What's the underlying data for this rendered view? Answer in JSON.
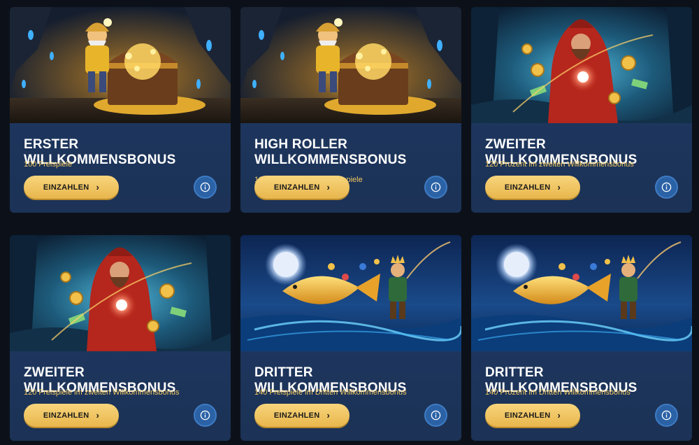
{
  "colors": {
    "page_bg": "#0c1119",
    "card_bg": "#1f3a66",
    "title": "#ffffff",
    "subtitle": "#f0c860",
    "button_gold": "#f2c665",
    "info_blue": "#2b62a6"
  },
  "cards": [
    {
      "image": "gnome-treasure-chest-illustration",
      "title": "ERSTER WILLKOMMENSBONUS",
      "subtitle": "100 Freispiele",
      "button_label": "EINZAHLEN",
      "button_icon": "chevron-right-icon",
      "info_icon": "info-icon"
    },
    {
      "image": "gnome-treasure-chest-illustration",
      "title": "HIGH ROLLER WILLKOMMENSBONUS",
      "subtitle": "100 Prozent plus 100 Freispiele",
      "button_label": "EINZAHLEN",
      "button_icon": "chevron-right-icon",
      "info_icon": "info-icon"
    },
    {
      "image": "wizard-magic-orb-illustration",
      "title": "ZWEITER WILLKOMMENSBONUS",
      "subtitle": "120 Prozent im zweiten Willkommensbonus",
      "button_label": "EINZAHLEN",
      "button_icon": "chevron-right-icon",
      "info_icon": "info-icon"
    },
    {
      "image": "wizard-magic-orb-illustration",
      "title": "ZWEITER WILLKOMMENSBONUS",
      "subtitle": "120 Freispiele im zweiten Willkommensbonus",
      "button_label": "EINZAHLEN",
      "button_icon": "chevron-right-icon",
      "info_icon": "info-icon"
    },
    {
      "image": "king-golden-fish-illustration",
      "title": "DRITTER WILLKOMMENSBONUS",
      "subtitle": "140 Freispiele im Dritten Willkommensbonus",
      "button_label": "EINZAHLEN",
      "button_icon": "chevron-right-icon",
      "info_icon": "info-icon"
    },
    {
      "image": "king-golden-fish-illustration",
      "title": "DRITTER WILLKOMMENSBONUS",
      "subtitle": "140 Prozent im Dritten Willkommensbonus",
      "button_label": "EINZAHLEN",
      "button_icon": "chevron-right-icon",
      "info_icon": "info-icon"
    }
  ]
}
